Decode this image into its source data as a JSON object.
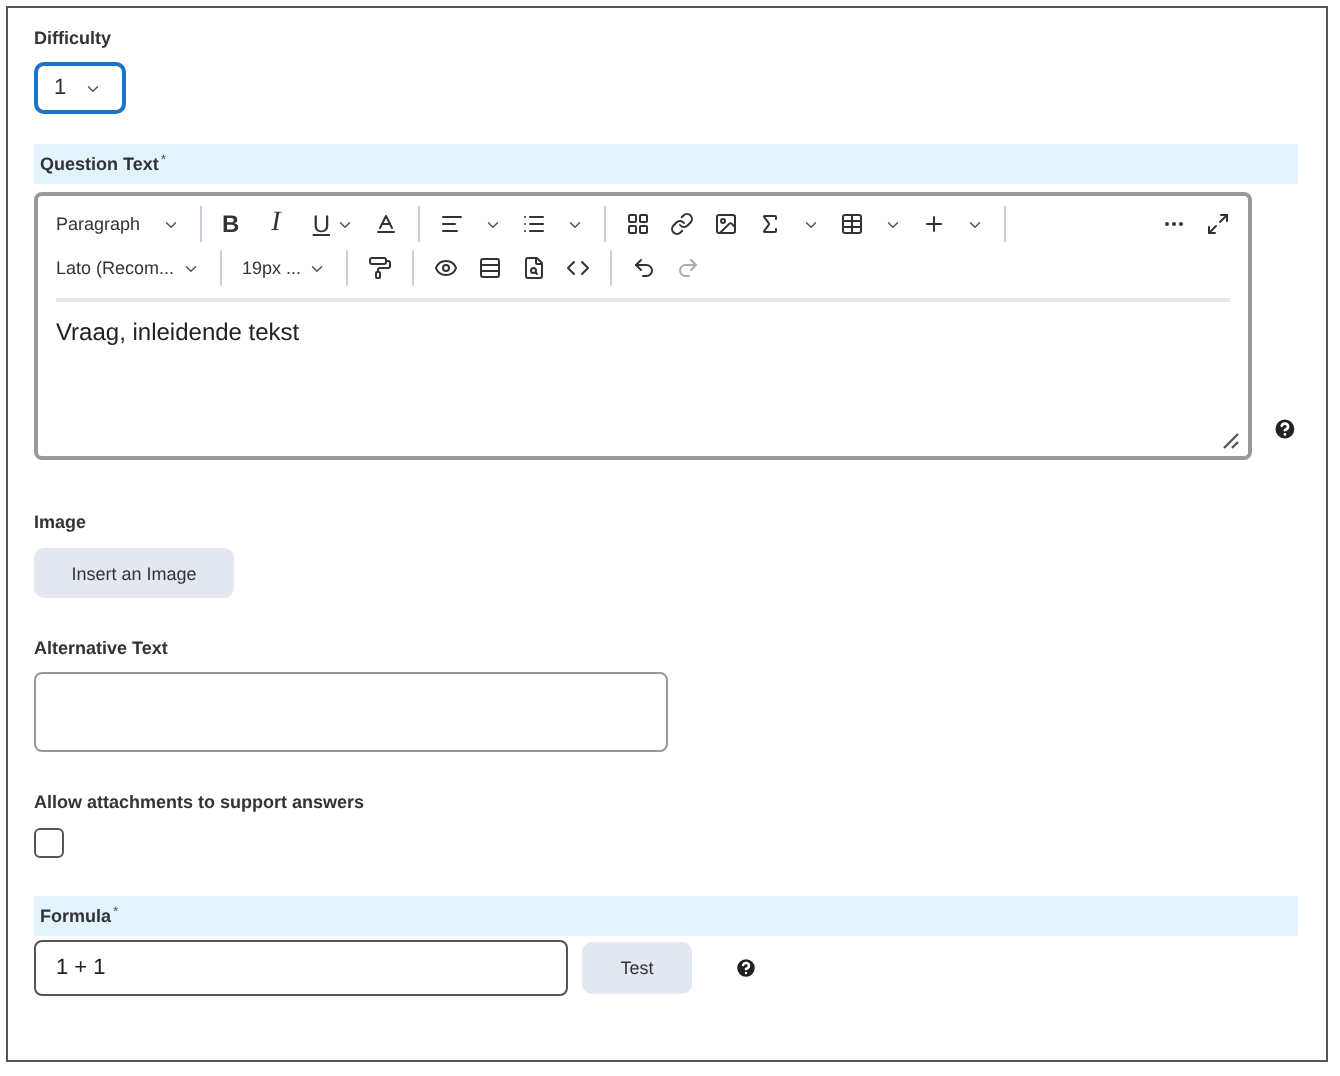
{
  "difficulty": {
    "label": "Difficulty",
    "value": "1"
  },
  "question_text": {
    "label": "Question Text",
    "required_mark": "*",
    "toolbar": {
      "block_format": "Paragraph",
      "bold": "B",
      "italic": "I",
      "underline": "U",
      "font": "Lato (Recom...",
      "size": "19px ..."
    },
    "value": "Vraag, inleidende tekst"
  },
  "image": {
    "label": "Image",
    "button": "Insert an Image"
  },
  "alternative_text": {
    "label": "Alternative Text"
  },
  "attachments": {
    "label": "Allow attachments to support answers",
    "checked": false
  },
  "formula": {
    "label": "Formula",
    "required_mark": "*",
    "value": "1 + 1",
    "button": "Test"
  }
}
